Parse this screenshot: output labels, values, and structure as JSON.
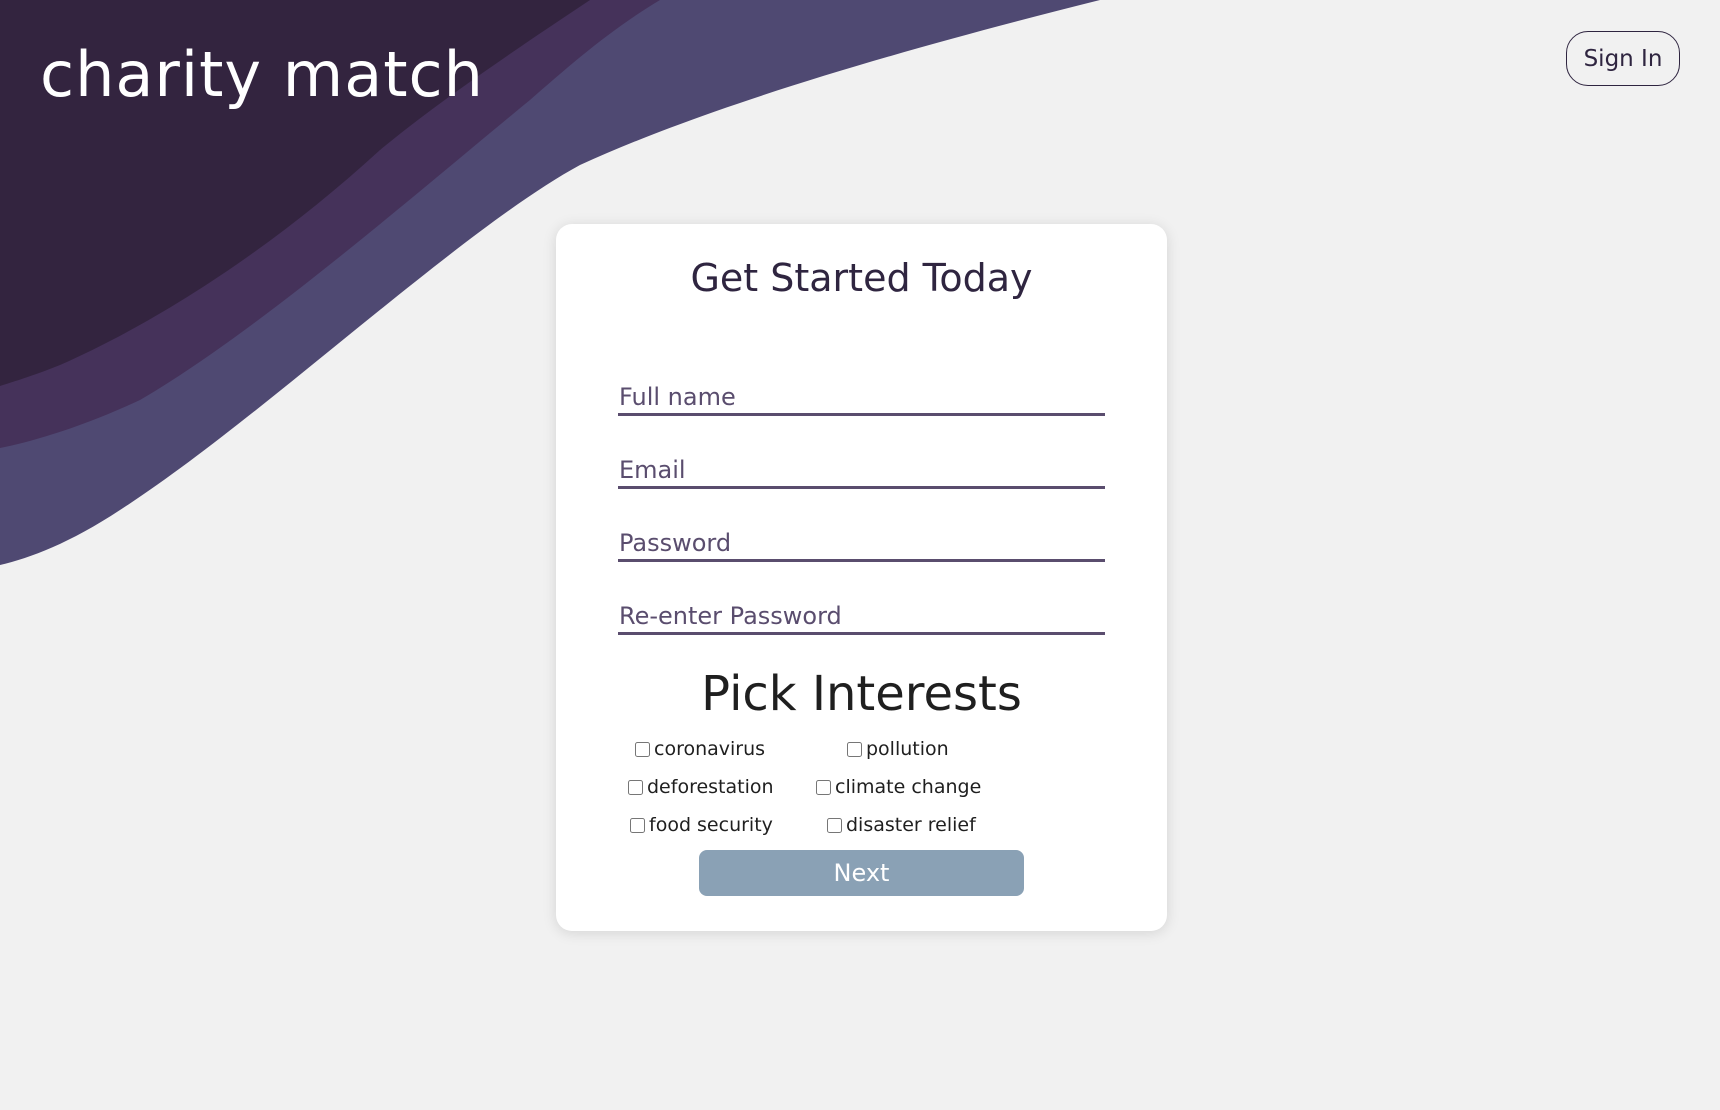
{
  "header": {
    "logo": "charity match",
    "sign_in_label": "Sign In"
  },
  "form": {
    "title": "Get Started Today",
    "fields": {
      "full_name": {
        "placeholder": "Full name",
        "value": ""
      },
      "email": {
        "placeholder": "Email",
        "value": ""
      },
      "password": {
        "placeholder": "Password",
        "value": ""
      },
      "reenter_password": {
        "placeholder": "Re-enter Password",
        "value": ""
      }
    },
    "interests_title": "Pick Interests",
    "interests": [
      {
        "label": "coronavirus",
        "checked": false
      },
      {
        "label": "pollution",
        "checked": false
      },
      {
        "label": "deforestation",
        "checked": false
      },
      {
        "label": "climate change",
        "checked": false
      },
      {
        "label": "food security",
        "checked": false
      },
      {
        "label": "disaster relief",
        "checked": false
      }
    ],
    "next_label": "Next"
  },
  "colors": {
    "wave_dark": "#33243f",
    "wave_mid": "#45325a",
    "wave_light": "#4f4972",
    "background": "#f1f1f1",
    "text_dark": "#2f2540",
    "next_button": "#8aa1b5"
  }
}
